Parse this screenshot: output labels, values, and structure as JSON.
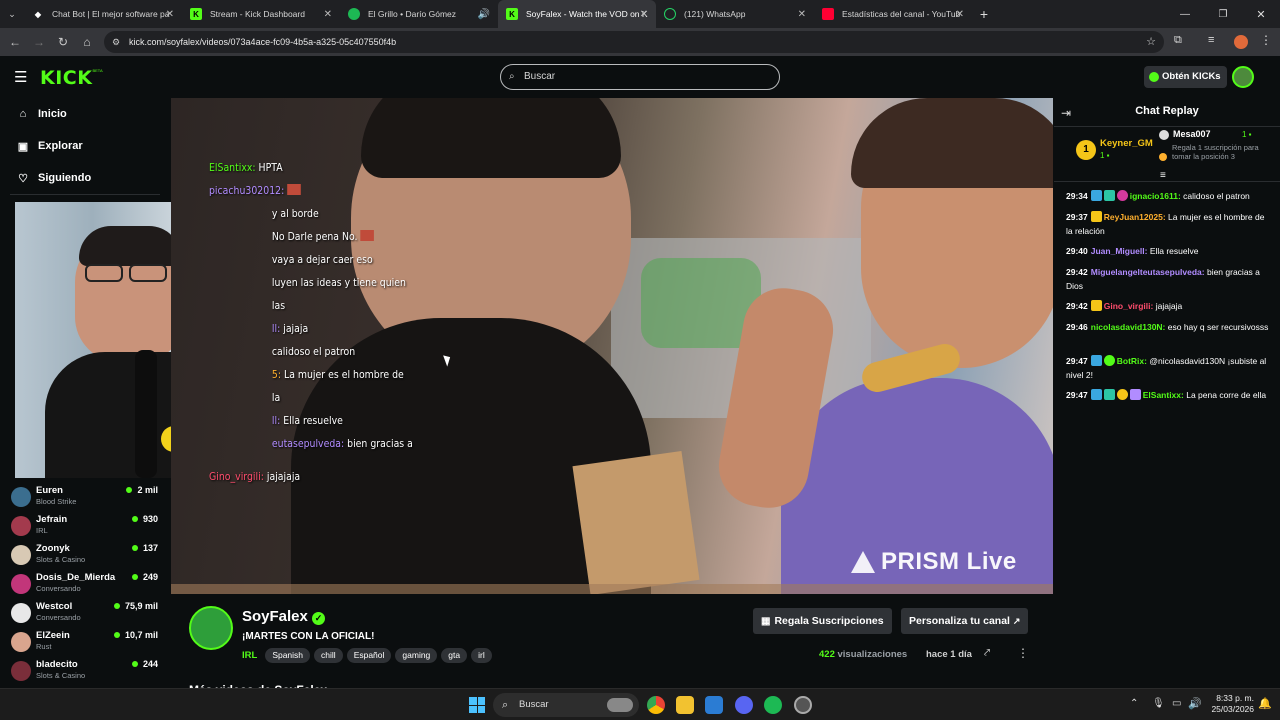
{
  "browser": {
    "tabs": [
      {
        "title": "Chat Bot | El mejor software pa",
        "active": false
      },
      {
        "title": "Stream - Kick Dashboard",
        "active": false
      },
      {
        "title": "El Grillo • Darío Gómez",
        "active": false
      },
      {
        "title": "SoyFalex - Watch the VOD on K",
        "active": true
      },
      {
        "title": "(121) WhatsApp",
        "active": false
      },
      {
        "title": "Estadísticas del canal - YouTub",
        "active": false
      }
    ],
    "new_tab": "+",
    "url": "kick.com/soyfalex/videos/073a4ace-fc09-4b5a-a325-05c407550f4b"
  },
  "header": {
    "logo": "KICK",
    "logo_sup": "BETA",
    "search_placeholder": "Buscar",
    "get_kicks": "Obtén KICKs"
  },
  "sidebar": {
    "nav": [
      {
        "label": "Inicio",
        "icon": "home-icon"
      },
      {
        "label": "Explorar",
        "icon": "compass-icon"
      },
      {
        "label": "Siguiendo",
        "icon": "heart-icon"
      }
    ],
    "channels": [
      {
        "name": "Euren",
        "category": "Blood Strike",
        "viewers": "2 mil",
        "color": "#3b6e8f"
      },
      {
        "name": "Jefrain",
        "category": "IRL",
        "viewers": "930",
        "color": "#a33a4d"
      },
      {
        "name": "Zoonyk",
        "category": "Slots & Casino",
        "viewers": "137",
        "color": "#d8c9b4"
      },
      {
        "name": "Dosis_De_Mierda",
        "category": "Conversando",
        "viewers": "249",
        "color": "#c2367a"
      },
      {
        "name": "Westcol",
        "category": "Conversando",
        "viewers": "75,9 mil",
        "color": "#e8e8e8"
      },
      {
        "name": "ElZeein",
        "category": "Rust",
        "viewers": "10,7 mil",
        "color": "#d9a58e"
      },
      {
        "name": "bladecito",
        "category": "Slots & Casino",
        "viewers": "244",
        "color": "#7a2e3a"
      }
    ]
  },
  "overlay_chat": [
    {
      "user": "ElSantixx:",
      "msg": "HPTA",
      "color": "#53fc18"
    },
    {
      "user": "picachu302012:",
      "msg": "",
      "color": "#b18cff"
    },
    {
      "user": "",
      "msg": "y al borde",
      "color": "#fff"
    },
    {
      "user": "",
      "msg": "No Darle pena No.",
      "color": "#fff"
    },
    {
      "user": "",
      "msg": "vaya a dejar caer eso",
      "color": "#fff"
    },
    {
      "user": "",
      "msg": "luyen las ideas y tiene quien las",
      "color": "#fff"
    },
    {
      "user": "ll:",
      "msg": "jajaja",
      "color": "#b18cff"
    },
    {
      "user": "",
      "msg": "calidoso el patron",
      "color": "#fff"
    },
    {
      "user": "5:",
      "msg": "La mujer es el hombre de la",
      "color": "#ffb02e"
    },
    {
      "user": "ll:",
      "msg": "Ella resuelve",
      "color": "#b18cff"
    },
    {
      "user": "eutasepulveda:",
      "msg": "bien gracias a",
      "color": "#b18cff"
    },
    {
      "user": "Gino_virgili:",
      "msg": "jajajaja",
      "color": "#ff4d6d"
    }
  ],
  "video": {
    "watermark": "PRISM Live"
  },
  "chat": {
    "title": "Chat Replay",
    "leaders": [
      {
        "rank": "1",
        "name": "Keyner_GM",
        "count": "1"
      },
      {
        "name": "Mesa007",
        "count": "1",
        "note": "Regala 1 suscripción para tomar la posición 3"
      }
    ],
    "messages": [
      {
        "time": "29:34",
        "user": "ignacio1611:",
        "msg": "calidoso el patron",
        "color": "#53fc18"
      },
      {
        "time": "29:37",
        "user": "ReyJuan12025:",
        "msg": "La mujer es el hombre de la relación",
        "color": "#ffb02e"
      },
      {
        "time": "29:40",
        "user": "Juan_Miguell:",
        "msg": "Ella resuelve",
        "color": "#b18cff"
      },
      {
        "time": "29:42",
        "user": "Miguelangelteutasepulveda:",
        "msg": "bien gracias a Dios",
        "color": "#b18cff"
      },
      {
        "time": "29:42",
        "user": "Gino_virgili:",
        "msg": "jajajaja",
        "color": "#ff4d6d"
      },
      {
        "time": "29:46",
        "user": "nicolasdavid130N:",
        "msg": "eso hay q ser recursivosss",
        "color": "#53fc18"
      },
      {
        "time": "29:47",
        "user": "BotRix:",
        "msg": "@nicolasdavid130N ¡subiste al nivel 2!",
        "color": "#53fc18"
      },
      {
        "time": "29:47",
        "user": "ElSantixx:",
        "msg": "La pena corre de ella",
        "color": "#53fc18"
      }
    ]
  },
  "stream": {
    "name": "SoyFalex",
    "title": "¡MARTES CON LA OFICIAL!",
    "category": "IRL",
    "tags": [
      "Spanish",
      "chill",
      "Español",
      "gaming",
      "gta",
      "irl"
    ],
    "views_count": "422",
    "views_label": "visualizaciones",
    "ago": "hace 1 día",
    "gift_btn": "Regala Suscripciones",
    "customize_btn": "Personaliza tu canal",
    "more_videos": "Más videos de SoyFalex"
  },
  "taskbar": {
    "search": "Buscar",
    "time": "8:33 p. m.",
    "date": "25/03/2026"
  }
}
